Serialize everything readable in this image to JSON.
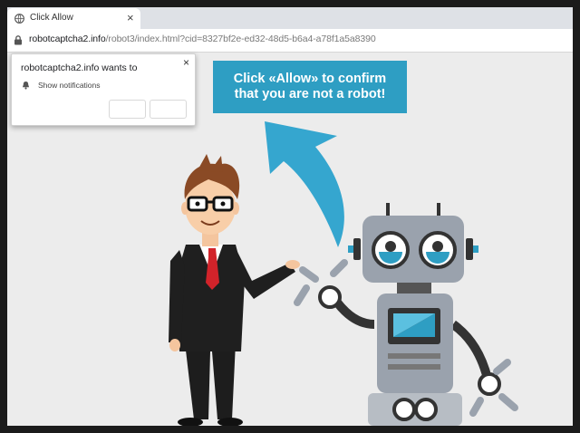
{
  "browser": {
    "tab": {
      "title": "Click Allow",
      "favicon": "globe-icon",
      "close": "×"
    },
    "address": {
      "domain": "robotcaptcha2.info",
      "path": "/robot3/index.html?cid=8327bf2e-ed32-48d5-b6a4-a78f1a5a8390",
      "lock_icon": "lock-icon"
    }
  },
  "permission_prompt": {
    "title": "robotcaptcha2.info wants to",
    "close": "×",
    "permission_icon": "bell-icon",
    "permission_label": "Show notifications",
    "block_label": "",
    "allow_label": ""
  },
  "page": {
    "cta_line1": "Click «Allow» to confirm",
    "cta_line2": "that you are not a robot!",
    "cta_color": "#2e9ec3",
    "arrow_color": "#35a6cf"
  }
}
